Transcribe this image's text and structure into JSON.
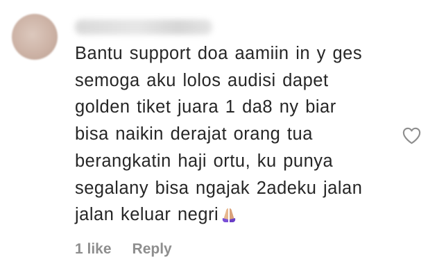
{
  "comment": {
    "username": "",
    "lines": [
      "Bantu support doa aamiin in y ges",
      "semoga aku lolos audisi dapet",
      "golden tiket juara 1 da8 ny biar",
      "bisa naikin derajat orang tua",
      "berangkatin haji ortu, ku punya",
      "segalany bisa ngajak 2adeku jalan",
      "jalan keluar negri"
    ],
    "emoji": "folded-hands-emoji",
    "like_count_label": "1 like",
    "reply_label": "Reply",
    "heart_icon": "heart-outline-icon",
    "text_color": "#262626",
    "meta_color": "#8e8e8e"
  }
}
